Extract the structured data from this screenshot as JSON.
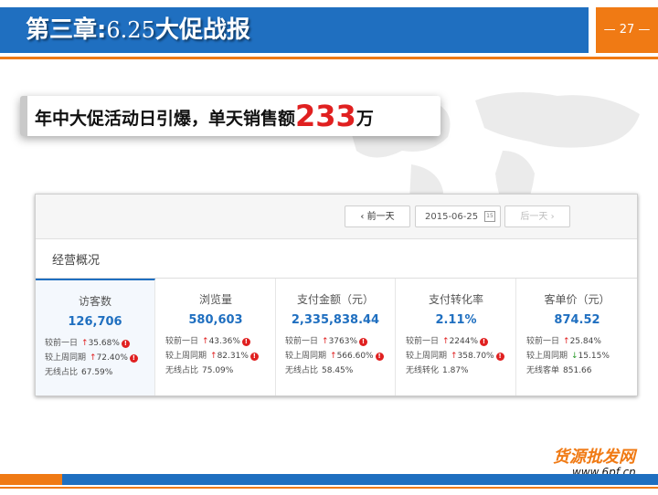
{
  "header": {
    "title_prefix": "第三章:",
    "title_number": "6.25",
    "title_suffix": "大促战报",
    "page_label": "— 27 —"
  },
  "callout": {
    "text": "年中大促活动日引爆，单天销售额",
    "number": "233",
    "unit": "万"
  },
  "dashboard": {
    "prev_button": "前一天",
    "date": "2015-06-25",
    "calendar_day": "15",
    "next_button": "后一天",
    "section_title": "经营概况",
    "metrics": [
      {
        "title": "访客数",
        "value": "126,706",
        "rows": [
          {
            "label": "较前一日",
            "value": "35.68%",
            "trend": "up"
          },
          {
            "label": "较上周同期",
            "value": "72.40%",
            "trend": "up"
          },
          {
            "label": "无线占比",
            "value": "67.59%"
          }
        ]
      },
      {
        "title": "浏览量",
        "value": "580,603",
        "rows": [
          {
            "label": "较前一日",
            "value": "43.36%",
            "trend": "up"
          },
          {
            "label": "较上周同期",
            "value": "82.31%",
            "trend": "up"
          },
          {
            "label": "无线占比",
            "value": "75.09%"
          }
        ]
      },
      {
        "title": "支付金额（元）",
        "value": "2,335,838.44",
        "rows": [
          {
            "label": "较前一日",
            "value": "3763%",
            "trend": "up"
          },
          {
            "label": "较上周同期",
            "value": "566.60%",
            "trend": "up"
          },
          {
            "label": "无线占比",
            "value": "58.45%"
          }
        ]
      },
      {
        "title": "支付转化率",
        "value": "2.11%",
        "rows": [
          {
            "label": "较前一日",
            "value": "2244%",
            "trend": "up"
          },
          {
            "label": "较上周同期",
            "value": "358.70%",
            "trend": "up"
          },
          {
            "label": "无线转化",
            "value": "1.87%"
          }
        ]
      },
      {
        "title": "客单价（元）",
        "value": "874.52",
        "rows": [
          {
            "label": "较前一日",
            "value": "25.84%",
            "trend": "up"
          },
          {
            "label": "较上周同期",
            "value": "15.15%",
            "trend": "down"
          },
          {
            "label": "无线客单",
            "value": "851.66"
          }
        ]
      }
    ]
  },
  "watermark": {
    "chinese": "货源批发网",
    "url": "www.6pf.cn"
  },
  "colors": {
    "primary_blue": "#1F6FC0",
    "accent_orange": "#F07A14",
    "alert_red": "#E02020",
    "down_green": "#2A9A2A"
  }
}
